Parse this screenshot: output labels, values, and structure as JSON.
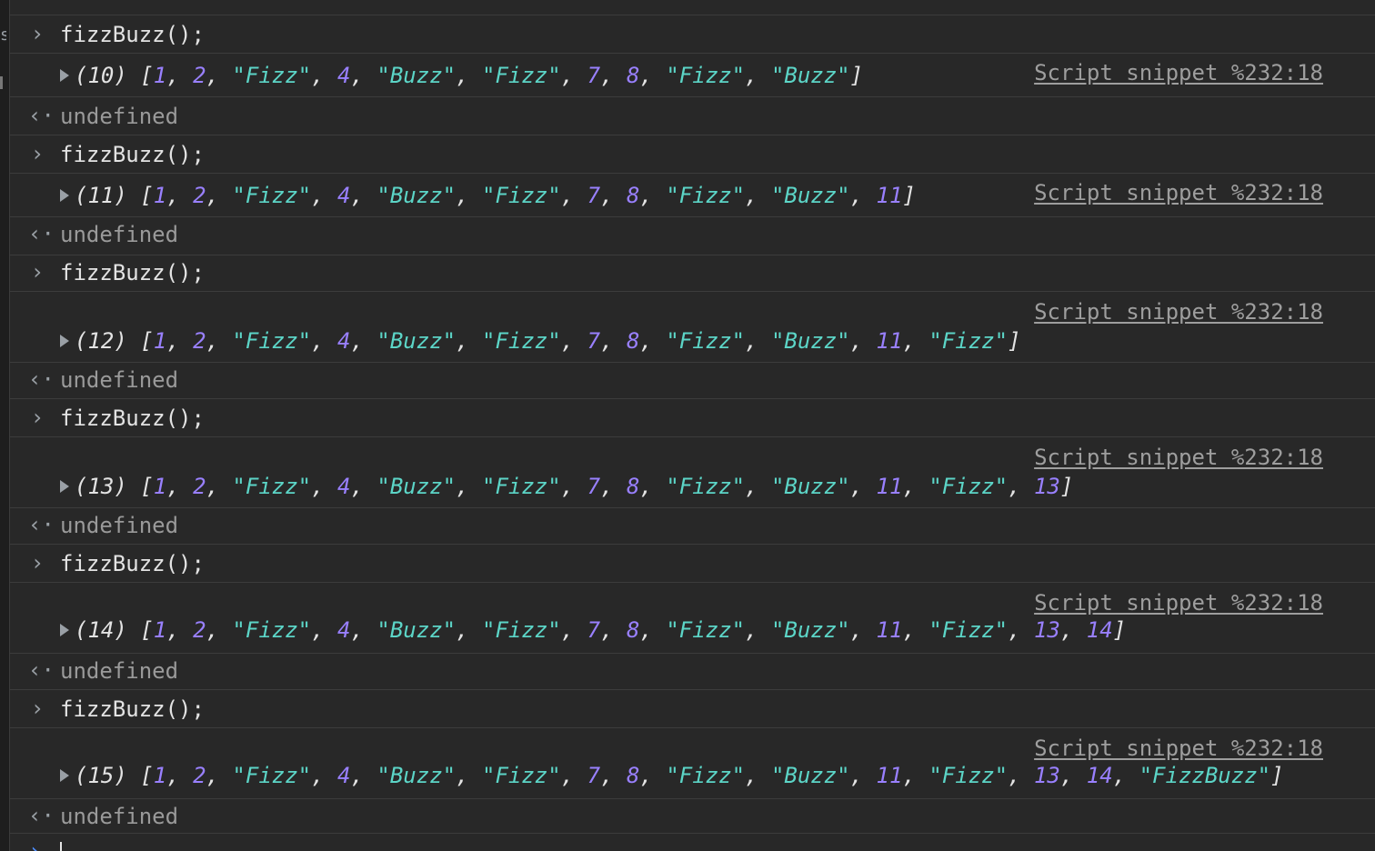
{
  "console": {
    "input_prompt_glyph": "›",
    "result_glyph": "‹·",
    "input_command": "fizzBuzz();",
    "result_text": "undefined",
    "source_link": "Script snippet %232:18",
    "entries": [
      {
        "length_label": "(10)",
        "items": [
          1,
          2,
          "Fizz",
          4,
          "Buzz",
          "Fizz",
          7,
          8,
          "Fizz",
          "Buzz"
        ]
      },
      {
        "length_label": "(11)",
        "items": [
          1,
          2,
          "Fizz",
          4,
          "Buzz",
          "Fizz",
          7,
          8,
          "Fizz",
          "Buzz",
          11
        ]
      },
      {
        "length_label": "(12)",
        "items": [
          1,
          2,
          "Fizz",
          4,
          "Buzz",
          "Fizz",
          7,
          8,
          "Fizz",
          "Buzz",
          11,
          "Fizz"
        ]
      },
      {
        "length_label": "(13)",
        "items": [
          1,
          2,
          "Fizz",
          4,
          "Buzz",
          "Fizz",
          7,
          8,
          "Fizz",
          "Buzz",
          11,
          "Fizz",
          13
        ]
      },
      {
        "length_label": "(14)",
        "items": [
          1,
          2,
          "Fizz",
          4,
          "Buzz",
          "Fizz",
          7,
          8,
          "Fizz",
          "Buzz",
          11,
          "Fizz",
          13,
          14
        ]
      },
      {
        "length_label": "(15)",
        "items": [
          1,
          2,
          "Fizz",
          4,
          "Buzz",
          "Fizz",
          7,
          8,
          "Fizz",
          "Buzz",
          11,
          "Fizz",
          13,
          14,
          "FizzBuzz"
        ]
      }
    ]
  },
  "colors": {
    "background": "#282828",
    "number": "#9980ff",
    "string": "#5cd5c7",
    "link": "#9e9e9e",
    "muted": "#9a9a9a"
  }
}
